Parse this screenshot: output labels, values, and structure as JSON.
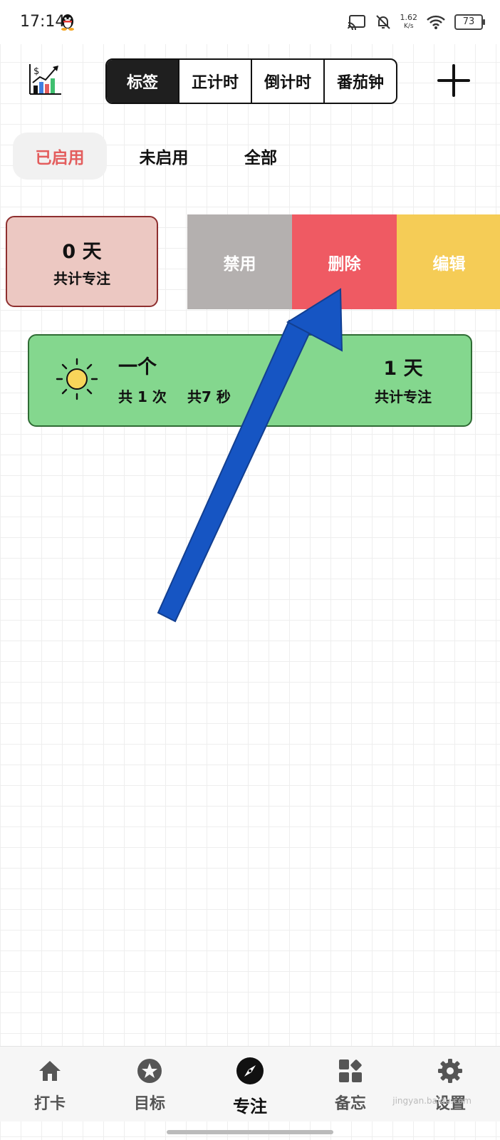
{
  "status_bar": {
    "time": "17:14",
    "net_speed": "1.62",
    "net_unit": "K/s",
    "battery": "73"
  },
  "tabs": {
    "items": [
      "标签",
      "正计时",
      "倒计时",
      "番茄钟"
    ],
    "active": 0
  },
  "filters": {
    "items": [
      "已启用",
      "未启用",
      "全部"
    ],
    "active": 0
  },
  "cards": [
    {
      "days": "0 天",
      "total_label": "共计专注",
      "color": "#ecc8c2"
    },
    {
      "name": "一个",
      "count_text": "共 1 次",
      "duration_text": "共7 秒",
      "days": "1 天",
      "total_label": "共计专注",
      "color": "#84d78e"
    }
  ],
  "swipe_actions": [
    {
      "label": "禁用",
      "color": "#b4b0af"
    },
    {
      "label": "删除",
      "color": "#ef5a63"
    },
    {
      "label": "编辑",
      "color": "#f5cc56"
    }
  ],
  "bottom_nav": {
    "items": [
      {
        "label": "打卡",
        "icon": "home-icon"
      },
      {
        "label": "目标",
        "icon": "star-icon"
      },
      {
        "label": "专注",
        "icon": "compass-icon"
      },
      {
        "label": "备忘",
        "icon": "widgets-icon"
      },
      {
        "label": "设置",
        "icon": "gear-icon"
      }
    ],
    "active": 2
  },
  "watermark": "jingyan.baidu.com",
  "colors": {
    "accent_red": "#e35d5d",
    "arrow_blue": "#1655c3",
    "dark": "#1f1f1f"
  }
}
